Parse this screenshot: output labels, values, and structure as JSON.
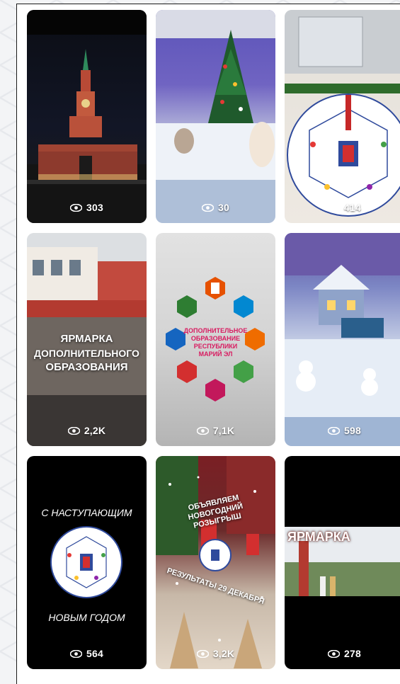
{
  "tiles": [
    {
      "views": "303"
    },
    {
      "views": "30"
    },
    {
      "views": "414"
    },
    {
      "views": "2,2K",
      "caption": [
        "ЯРМАРКА",
        "ДОПОЛНИТЕЛЬНОГО",
        "ОБРАЗОВАНИЯ"
      ]
    },
    {
      "views": "7,1K",
      "caption": [
        "ДОПОЛНИТЕЛЬНОЕ",
        "ОБРАЗОВАНИЕ",
        "РЕСПУБЛИКИ",
        "МАРИЙ ЭЛ"
      ]
    },
    {
      "views": "598"
    },
    {
      "views": "564",
      "caption_top": "С НАСТУПАЮЩИМ",
      "caption_bottom": "НОВЫМ ГОДОМ"
    },
    {
      "views": "3,2K",
      "caption_top": "ОБЪЯВЛЯЕМ НОВОГОДНИЙ РОЗЫГРЫШ",
      "caption_bottom": "РЕЗУЛЬТАТЫ 29 ДЕКАБРЯ"
    },
    {
      "views": "278",
      "caption": "ЯРМАРКА"
    }
  ],
  "colors": {
    "views_text": "#ffffff",
    "logo_blue": "#2f4a9c"
  },
  "icons": {
    "views": "eye-icon"
  }
}
